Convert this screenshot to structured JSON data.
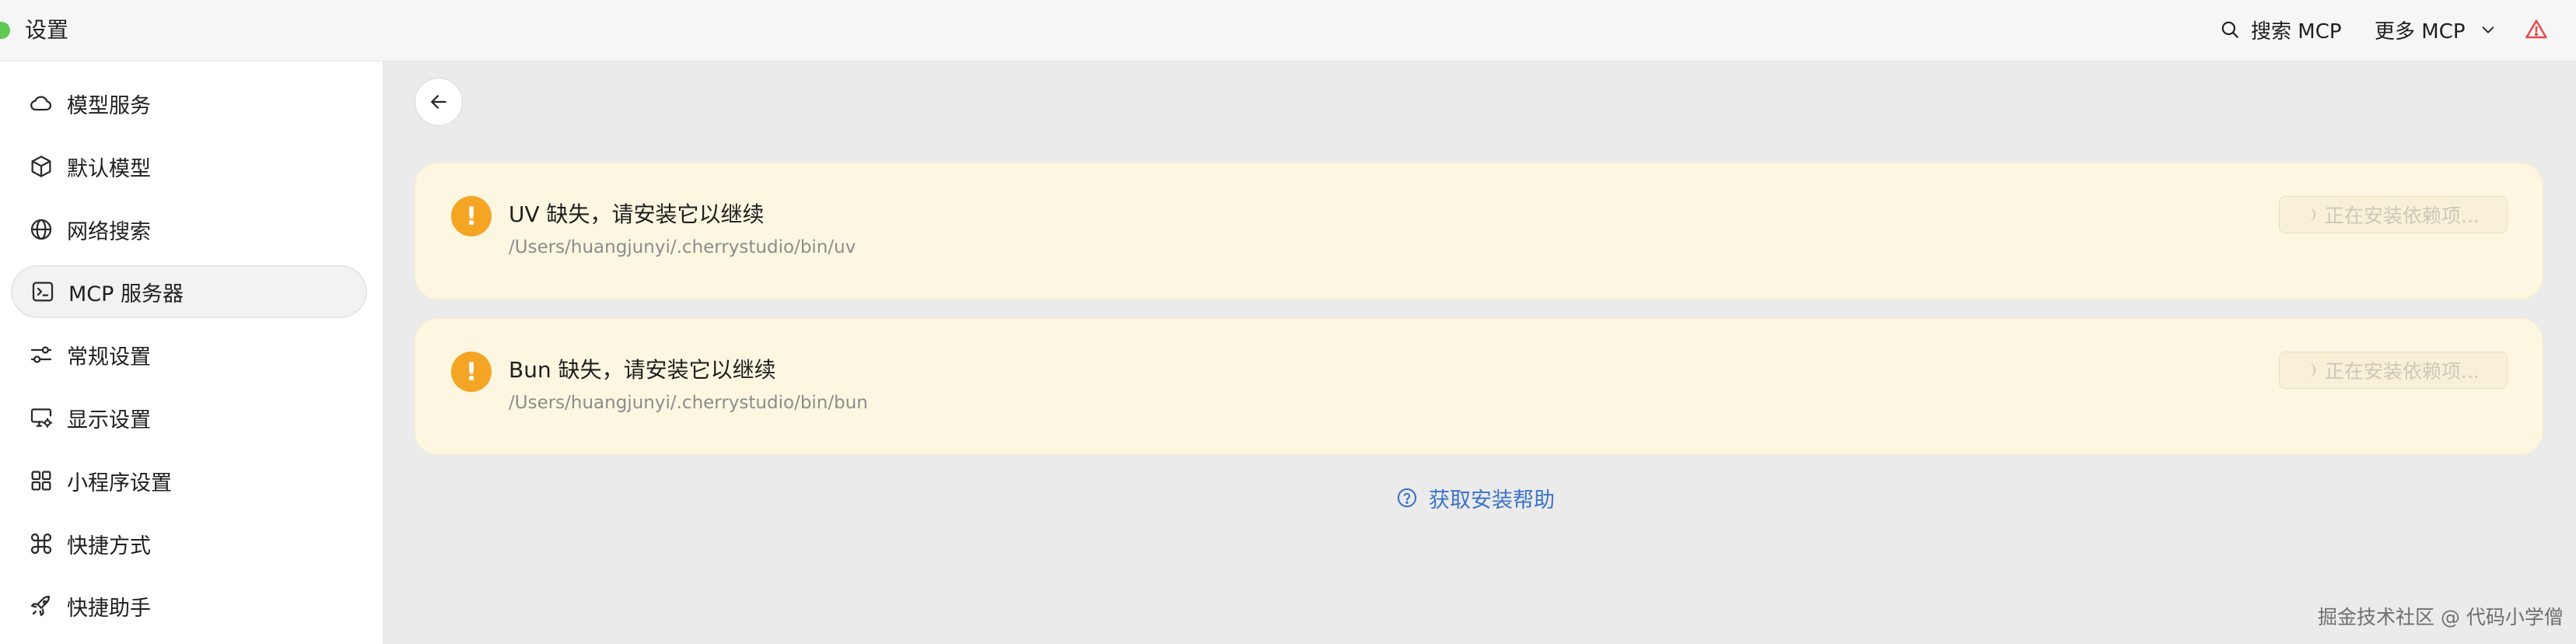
{
  "app": {
    "title": "设置",
    "status_color": "#5fc952"
  },
  "topbar": {
    "search_label": "搜索 MCP",
    "search_icon": "search-icon",
    "more_label": "更多 MCP",
    "more_icon": "chevron-down-icon",
    "warning_icon": "warning-triangle-icon",
    "warning_color": "#e5484d"
  },
  "sidebar": {
    "items": [
      {
        "label": "模型服务",
        "icon": "cloud-icon",
        "active": false
      },
      {
        "label": "默认模型",
        "icon": "cube-icon",
        "active": false
      },
      {
        "label": "网络搜索",
        "icon": "globe-icon",
        "active": false
      },
      {
        "label": "MCP 服务器",
        "icon": "terminal-icon",
        "active": true
      },
      {
        "label": "常规设置",
        "icon": "sliders-icon",
        "active": false
      },
      {
        "label": "显示设置",
        "icon": "monitor-settings-icon",
        "active": false
      },
      {
        "label": "小程序设置",
        "icon": "grid-icon",
        "active": false
      },
      {
        "label": "快捷方式",
        "icon": "command-icon",
        "active": false
      },
      {
        "label": "快捷助手",
        "icon": "rocket-icon",
        "active": false
      }
    ]
  },
  "main": {
    "back_icon": "arrow-left-icon",
    "alerts": [
      {
        "icon": "exclamation-icon",
        "title": "UV 缺失，请安装它以继续",
        "path": "/Users/huangjunyi/.cherrystudio/bin/uv",
        "button_label": "正在安装依赖项..."
      },
      {
        "icon": "exclamation-icon",
        "title": "Bun 缺失，请安装它以继续",
        "path": "/Users/huangjunyi/.cherrystudio/bin/bun",
        "button_label": "正在安装依赖项..."
      }
    ],
    "help_link": "获取安装帮助",
    "help_icon": "question-circle-icon",
    "accent_color": "#3b73c9",
    "alert_color": "#f5a524"
  },
  "watermark": "掘金技术社区 @ 代码小学僧"
}
